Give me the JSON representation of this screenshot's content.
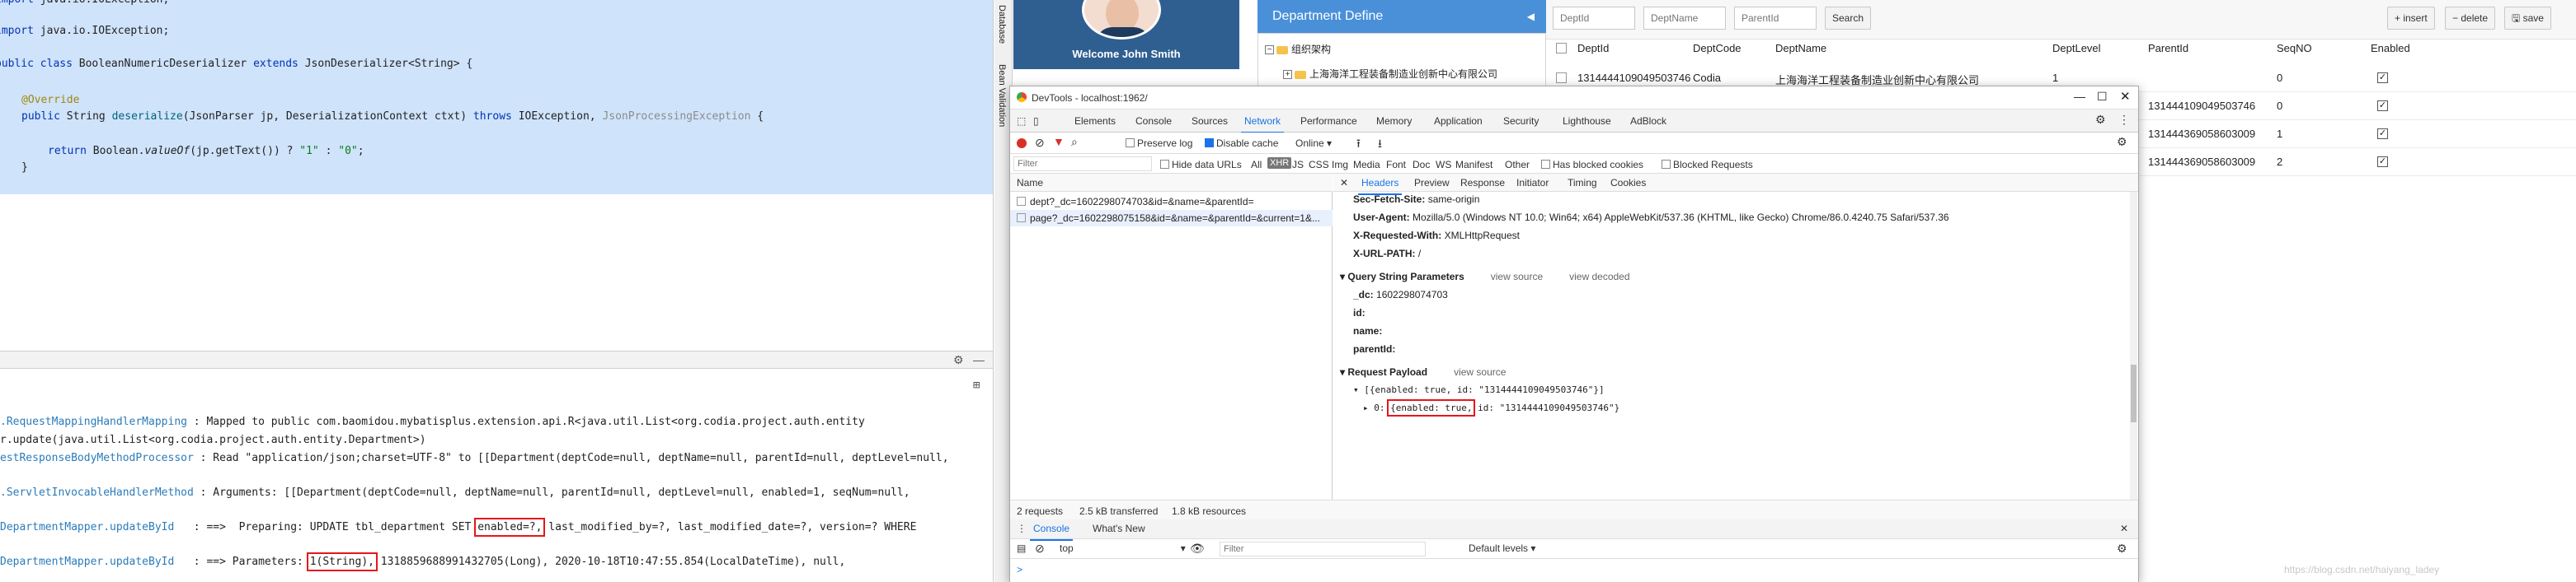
{
  "ide": {
    "code_lines": {
      "import": [
        "import ",
        "java.io.IOException;"
      ],
      "cls": [
        "public ",
        "class ",
        "BooleanNumericDeserializer ",
        "extends ",
        "JsonDeserializer<String> {"
      ],
      "override": "@Override",
      "method": [
        "public ",
        "String ",
        "deserialize",
        "(JsonParser jp, DeserializationContext ctxt) ",
        "throws ",
        "IOException, ",
        "JsonProcessingException",
        " {"
      ],
      "ret": [
        "return ",
        "Boolean.",
        "valueOf",
        "(jp.getText()) ? ",
        "\"1\"",
        " : ",
        "\"0\"",
        ";"
      ],
      "close": "}"
    },
    "console_lines": {
      "l1": [
        ".RequestMappingHandlerMapping",
        " : Mapped to public com.baomidou.mybatisplus.extension.api.R<java.util.List<org.codia.project.auth.entity"
      ],
      "l2": "r.update(java.util.List<org.codia.project.auth.entity.Department>)",
      "l3": [
        "estResponseBodyMethodProcessor",
        " : Read \"application/json;charset=UTF-8\" to [[Department(deptCode=null, deptName=null, parentId=null, deptLevel=null,"
      ],
      "l4": [
        ".ServletInvocableHandlerMethod",
        " : Arguments: [[Department(deptCode=null, deptName=null, parentId=null, deptLevel=null, enabled=1, seqNum=null,"
      ],
      "l5": [
        "DepartmentMapper.updateById",
        "   : ==>  Preparing: UPDATE tbl_department SET ",
        "enabled=?,",
        " last_modified_by=?, last_modified_date=?, version=? WHERE"
      ],
      "l6": [
        "DepartmentMapper.updateById",
        "   : ==> Parameters: ",
        "1(String),",
        " 1318859688991432705(Long), 2020-10-18T10:47:55.854(LocalDateTime), null,"
      ]
    }
  },
  "sidebar_tabs": [
    "Database",
    "Bean Validation"
  ],
  "app": {
    "welcome": "Welcome John Smith",
    "dept_header": "Department Define",
    "tree": {
      "root": "组织架构",
      "child": "上海海洋工程装备制造业创新中心有限公司"
    },
    "filters": [
      {
        "placeholder": "DeptId"
      },
      {
        "placeholder": "DeptName"
      },
      {
        "placeholder": "ParentId"
      }
    ],
    "search_label": "Search",
    "insert_label": "+ insert",
    "delete_label": "− delete",
    "save_label": "save",
    "columns": [
      "DeptId",
      "DeptCode",
      "DeptName",
      "DeptLevel",
      "ParentId",
      "SeqNO",
      "Enabled"
    ],
    "rows": [
      {
        "dept_id": "1314444109049503746",
        "dept_code": "Codia",
        "dept_name": "上海海洋工程装备制造业创新中心有限公司",
        "dept_level": "1",
        "parent_id": "",
        "seq": "0"
      },
      {
        "dept_id": "",
        "dept_code": "",
        "dept_name": "",
        "dept_level": "",
        "parent_id": "1314441090495037​46",
        "seq": "0"
      },
      {
        "dept_id": "",
        "dept_code": "",
        "dept_name": "",
        "dept_level": "",
        "parent_id": "1314443690586030​09",
        "seq": "1"
      },
      {
        "dept_id": "",
        "dept_code": "",
        "dept_name": "",
        "dept_level": "",
        "parent_id": "1314443690586030​09",
        "seq": "2"
      }
    ]
  },
  "devtools": {
    "title": "DevTools - localhost:1962/",
    "tabs": [
      "Elements",
      "Console",
      "Sources",
      "Network",
      "Performance",
      "Memory",
      "Application",
      "Security",
      "Lighthouse",
      "AdBlock"
    ],
    "active_tab": "Network",
    "controls": {
      "preserve_log": "Preserve log",
      "disable_cache": "Disable cache",
      "online": "Online"
    },
    "filter": {
      "placeholder": "Filter",
      "hide_data_urls": "Hide data URLs",
      "all": "All",
      "xhr": "XHR",
      "types": [
        "JS",
        "CSS",
        "Img",
        "Media",
        "Font",
        "Doc",
        "WS",
        "Manifest",
        "Other"
      ],
      "has_blocked_cookies": "Has blocked cookies",
      "blocked_requests": "Blocked Requests"
    },
    "list_header": "Name",
    "requests": [
      "dept?_dc=1602298074703&id=&name=&parentId=",
      "page?_dc=1602298075158&id=&name=&parentId=&current=1&..."
    ],
    "status": {
      "requests": "2 requests",
      "transferred": "2.5 kB transferred",
      "resources": "1.8 kB resources"
    },
    "detail_tabs": [
      "Headers",
      "Preview",
      "Response",
      "Initiator",
      "Timing",
      "Cookies"
    ],
    "headers": [
      {
        "k": "Sec-Fetch-Site:",
        "v": "same-origin"
      },
      {
        "k": "User-Agent:",
        "v": "Mozilla/5.0 (Windows NT 10.0; Win64; x64) AppleWebKit/537.36 (KHTML, like Gecko) Chrome/86.0.4240.75 Safari/537.36"
      },
      {
        "k": "X-Requested-With:",
        "v": "XMLHttpRequest"
      },
      {
        "k": "X-URL-PATH:",
        "v": "/"
      }
    ],
    "query_section": "Query String Parameters",
    "view_source": "view source",
    "view_decoded": "view decoded",
    "query_params": [
      {
        "k": "_dc:",
        "v": "1602298074703"
      },
      {
        "k": "id:",
        "v": ""
      },
      {
        "k": "name:",
        "v": ""
      },
      {
        "k": "parentId:",
        "v": ""
      }
    ],
    "payload_section": "Request Payload",
    "payload_line1": "[{enabled: true, id: \"1314444109049503746\"}]",
    "payload_line2_prefix": "0: ",
    "payload_line2_box": "{enabled: true,",
    "payload_line2_suffix": " id: \"1314444109049503746\"}",
    "console_tabs": [
      "Console",
      "What's New"
    ],
    "context": "top",
    "console_filter": "Filter",
    "levels": "Default levels ▾",
    "prompt": ">"
  },
  "watermark": "https://blog.csdn.net/haiyang_ladey"
}
